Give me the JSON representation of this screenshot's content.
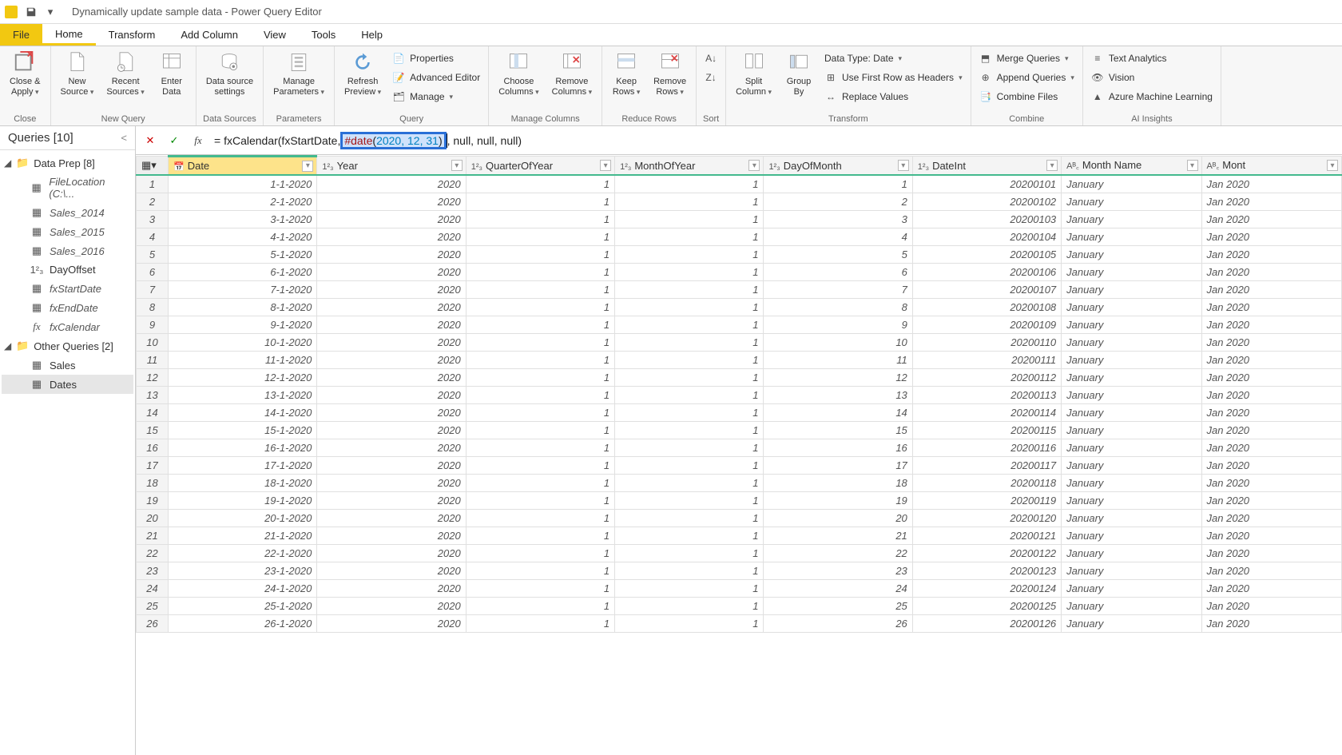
{
  "title": "Dynamically update sample data - Power Query Editor",
  "menu": {
    "file": "File",
    "tabs": [
      "Home",
      "Transform",
      "Add Column",
      "View",
      "Tools",
      "Help"
    ],
    "active": "Home"
  },
  "ribbon": {
    "close": {
      "close_apply": "Close &\nApply",
      "group": "Close"
    },
    "newquery": {
      "new_source": "New\nSource",
      "recent_sources": "Recent\nSources",
      "enter_data": "Enter\nData",
      "group": "New Query"
    },
    "datasources": {
      "settings": "Data source\nsettings",
      "group": "Data Sources"
    },
    "parameters": {
      "manage": "Manage\nParameters",
      "group": "Parameters"
    },
    "query": {
      "refresh": "Refresh\nPreview",
      "properties": "Properties",
      "advanced": "Advanced Editor",
      "manage": "Manage",
      "group": "Query"
    },
    "managecols": {
      "choose": "Choose\nColumns",
      "remove": "Remove\nColumns",
      "group": "Manage Columns"
    },
    "rows": {
      "keep": "Keep\nRows",
      "remove": "Remove\nRows",
      "group": "Reduce Rows"
    },
    "sort": {
      "group": "Sort"
    },
    "transform": {
      "split": "Split\nColumn",
      "groupby": "Group\nBy",
      "datatype": "Data Type: Date",
      "firstrow": "Use First Row as Headers",
      "replace": "Replace Values",
      "group": "Transform"
    },
    "combine": {
      "merge": "Merge Queries",
      "append": "Append Queries",
      "files": "Combine Files",
      "group": "Combine"
    },
    "ai": {
      "text": "Text Analytics",
      "vision": "Vision",
      "ml": "Azure Machine Learning",
      "group": "AI Insights"
    }
  },
  "queries": {
    "title": "Queries [10]",
    "groups": [
      {
        "name": "Data Prep [8]",
        "items": [
          {
            "label": "FileLocation (C:\\...",
            "icon": "table",
            "style": "param"
          },
          {
            "label": "Sales_2014",
            "icon": "table",
            "style": "italic"
          },
          {
            "label": "Sales_2015",
            "icon": "table",
            "style": "italic"
          },
          {
            "label": "Sales_2016",
            "icon": "table",
            "style": "italic"
          },
          {
            "label": "DayOffset",
            "icon": "123",
            "style": "normal"
          },
          {
            "label": "fxStartDate",
            "icon": "table",
            "style": "italic"
          },
          {
            "label": "fxEndDate",
            "icon": "table",
            "style": "italic"
          },
          {
            "label": "fxCalendar",
            "icon": "fx",
            "style": "italic"
          }
        ]
      },
      {
        "name": "Other Queries [2]",
        "items": [
          {
            "label": "Sales",
            "icon": "table",
            "style": "normal"
          },
          {
            "label": "Dates",
            "icon": "table",
            "style": "normal",
            "selected": true
          }
        ]
      }
    ]
  },
  "formula": {
    "prefix": "= fxCalendar(fxStartDate, ",
    "highlight_kw": "#date",
    "highlight_open": "(",
    "highlight_args": "2020, 12, 31",
    "highlight_close": ")",
    "suffix": ", null, null, null)"
  },
  "columns": [
    {
      "name": "Date",
      "type": "date",
      "selected": true
    },
    {
      "name": "Year",
      "type": "num"
    },
    {
      "name": "QuarterOfYear",
      "type": "num"
    },
    {
      "name": "MonthOfYear",
      "type": "num"
    },
    {
      "name": "DayOfMonth",
      "type": "num"
    },
    {
      "name": "DateInt",
      "type": "num"
    },
    {
      "name": "Month Name",
      "type": "text"
    },
    {
      "name": "Mont",
      "type": "text"
    }
  ],
  "rows": [
    [
      "1-1-2020",
      "2020",
      "1",
      "1",
      "1",
      "20200101",
      "January",
      "Jan 2020"
    ],
    [
      "2-1-2020",
      "2020",
      "1",
      "1",
      "2",
      "20200102",
      "January",
      "Jan 2020"
    ],
    [
      "3-1-2020",
      "2020",
      "1",
      "1",
      "3",
      "20200103",
      "January",
      "Jan 2020"
    ],
    [
      "4-1-2020",
      "2020",
      "1",
      "1",
      "4",
      "20200104",
      "January",
      "Jan 2020"
    ],
    [
      "5-1-2020",
      "2020",
      "1",
      "1",
      "5",
      "20200105",
      "January",
      "Jan 2020"
    ],
    [
      "6-1-2020",
      "2020",
      "1",
      "1",
      "6",
      "20200106",
      "January",
      "Jan 2020"
    ],
    [
      "7-1-2020",
      "2020",
      "1",
      "1",
      "7",
      "20200107",
      "January",
      "Jan 2020"
    ],
    [
      "8-1-2020",
      "2020",
      "1",
      "1",
      "8",
      "20200108",
      "January",
      "Jan 2020"
    ],
    [
      "9-1-2020",
      "2020",
      "1",
      "1",
      "9",
      "20200109",
      "January",
      "Jan 2020"
    ],
    [
      "10-1-2020",
      "2020",
      "1",
      "1",
      "10",
      "20200110",
      "January",
      "Jan 2020"
    ],
    [
      "11-1-2020",
      "2020",
      "1",
      "1",
      "11",
      "20200111",
      "January",
      "Jan 2020"
    ],
    [
      "12-1-2020",
      "2020",
      "1",
      "1",
      "12",
      "20200112",
      "January",
      "Jan 2020"
    ],
    [
      "13-1-2020",
      "2020",
      "1",
      "1",
      "13",
      "20200113",
      "January",
      "Jan 2020"
    ],
    [
      "14-1-2020",
      "2020",
      "1",
      "1",
      "14",
      "20200114",
      "January",
      "Jan 2020"
    ],
    [
      "15-1-2020",
      "2020",
      "1",
      "1",
      "15",
      "20200115",
      "January",
      "Jan 2020"
    ],
    [
      "16-1-2020",
      "2020",
      "1",
      "1",
      "16",
      "20200116",
      "January",
      "Jan 2020"
    ],
    [
      "17-1-2020",
      "2020",
      "1",
      "1",
      "17",
      "20200117",
      "January",
      "Jan 2020"
    ],
    [
      "18-1-2020",
      "2020",
      "1",
      "1",
      "18",
      "20200118",
      "January",
      "Jan 2020"
    ],
    [
      "19-1-2020",
      "2020",
      "1",
      "1",
      "19",
      "20200119",
      "January",
      "Jan 2020"
    ],
    [
      "20-1-2020",
      "2020",
      "1",
      "1",
      "20",
      "20200120",
      "January",
      "Jan 2020"
    ],
    [
      "21-1-2020",
      "2020",
      "1",
      "1",
      "21",
      "20200121",
      "January",
      "Jan 2020"
    ],
    [
      "22-1-2020",
      "2020",
      "1",
      "1",
      "22",
      "20200122",
      "January",
      "Jan 2020"
    ],
    [
      "23-1-2020",
      "2020",
      "1",
      "1",
      "23",
      "20200123",
      "January",
      "Jan 2020"
    ],
    [
      "24-1-2020",
      "2020",
      "1",
      "1",
      "24",
      "20200124",
      "January",
      "Jan 2020"
    ],
    [
      "25-1-2020",
      "2020",
      "1",
      "1",
      "25",
      "20200125",
      "January",
      "Jan 2020"
    ],
    [
      "26-1-2020",
      "2020",
      "1",
      "1",
      "26",
      "20200126",
      "January",
      "Jan 2020"
    ]
  ]
}
